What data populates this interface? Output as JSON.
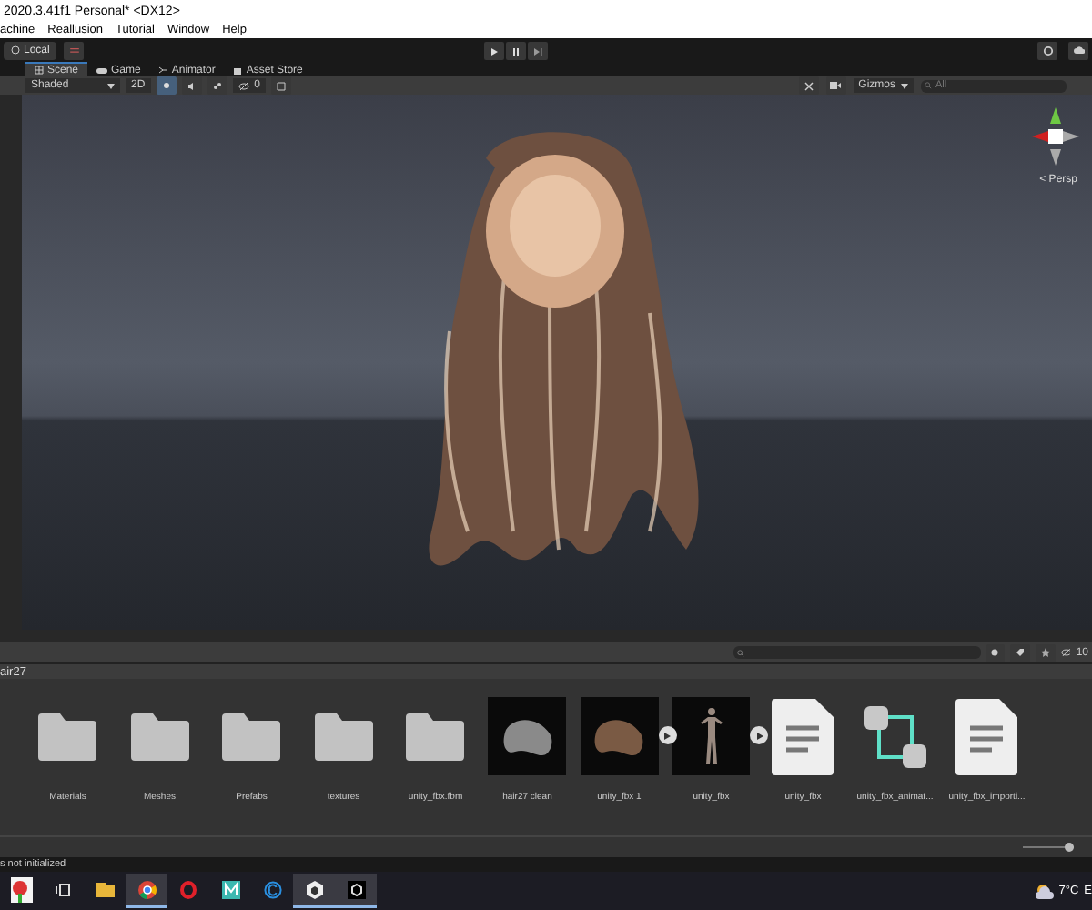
{
  "window": {
    "title": "2020.3.41f1 Personal* <DX12>"
  },
  "menu": [
    "achine",
    "Reallusion",
    "Tutorial",
    "Window",
    "Help"
  ],
  "toolbar": {
    "account": "Local",
    "playing": false
  },
  "tabs": [
    {
      "label": "Scene",
      "kind": "scene",
      "selected": true
    },
    {
      "label": "Game",
      "kind": "game",
      "selected": false
    },
    {
      "label": "Animator",
      "kind": "animator",
      "selected": false
    },
    {
      "label": "Asset Store",
      "kind": "store",
      "selected": false
    }
  ],
  "scene_toolbar": {
    "draw_mode": "Shaded",
    "mode_2d": "2D",
    "gizmos": "Gizmos",
    "search_placeholder": "All",
    "hidden_count": "0"
  },
  "scene": {
    "view_label": "< Persp"
  },
  "project": {
    "breadcrumb": "air27",
    "hidden_count": "10",
    "level": 0.9,
    "assets": [
      {
        "name": "Materials",
        "kind": "folder"
      },
      {
        "name": "Meshes",
        "kind": "folder"
      },
      {
        "name": "Prefabs",
        "kind": "folder"
      },
      {
        "name": "textures",
        "kind": "folder"
      },
      {
        "name": "unity_fbx.fbm",
        "kind": "folder"
      },
      {
        "name": "hair27 clean",
        "kind": "model"
      },
      {
        "name": "unity_fbx 1",
        "kind": "model",
        "expandable": true
      },
      {
        "name": "unity_fbx",
        "kind": "figure",
        "expandable": true
      },
      {
        "name": "unity_fbx",
        "kind": "file"
      },
      {
        "name": "unity_fbx_animat...",
        "kind": "animator"
      },
      {
        "name": "unity_fbx_importi...",
        "kind": "file"
      }
    ]
  },
  "status_bar": "s not initialized",
  "taskbar": {
    "apps": [
      {
        "kind": "flower",
        "active": false
      },
      {
        "kind": "taskview",
        "active": false
      },
      {
        "kind": "explorer",
        "active": false
      },
      {
        "kind": "chrome",
        "active": true
      },
      {
        "kind": "opera",
        "active": false
      },
      {
        "kind": "m",
        "active": false
      },
      {
        "kind": "c",
        "active": false
      },
      {
        "kind": "unityhub",
        "active": true
      },
      {
        "kind": "unity",
        "active": true
      }
    ],
    "temperature": "7°C",
    "tray_letter": "E"
  }
}
